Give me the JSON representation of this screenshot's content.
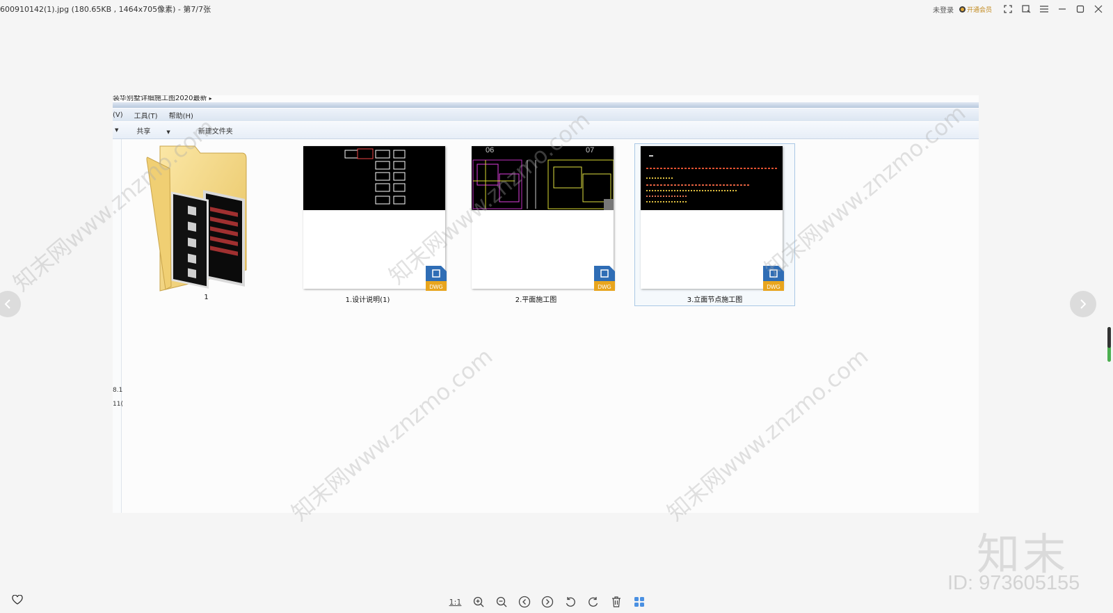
{
  "window": {
    "title": "600910142(1).jpg (180.65KB , 1464x705像素) - 第7/7张",
    "login": "未登录",
    "vip": "开通会员"
  },
  "explorer": {
    "address_fragment": "装华别墅详细施工图2020最新",
    "menus": [
      "(V)",
      "工具(T)",
      "帮助(H)"
    ],
    "toolbar": [
      "共享",
      "新建文件夹"
    ],
    "left_fragments": [
      "8.1",
      "11("
    ],
    "files": [
      {
        "name": "1",
        "type": "folder"
      },
      {
        "name": "1.设计说明(1)",
        "type": "dwg"
      },
      {
        "name": "2.平面施工图",
        "type": "dwg",
        "sheet_numbers": [
          "06",
          "07"
        ]
      },
      {
        "name": "3.立面节点施工图",
        "type": "dwg",
        "selected": true
      }
    ],
    "dwg_badge": "DWG"
  },
  "bottom_toolbar": {
    "actual_size": "1:1",
    "icons": [
      "zoom-in-icon",
      "zoom-out-icon",
      "previous-icon",
      "next-icon",
      "rotate-left-icon",
      "rotate-right-icon",
      "delete-icon",
      "thumbnails-icon"
    ]
  },
  "brand": {
    "logo": "知末",
    "id": "ID: 973605155"
  },
  "watermark": "知末网www.znzmo.com",
  "colors": {
    "background": "#f5f5f5",
    "folder": "#f2d27a",
    "dwg_blue": "#2f6db5",
    "dwg_orange": "#e8a51e",
    "selection": "#aac8e5"
  }
}
